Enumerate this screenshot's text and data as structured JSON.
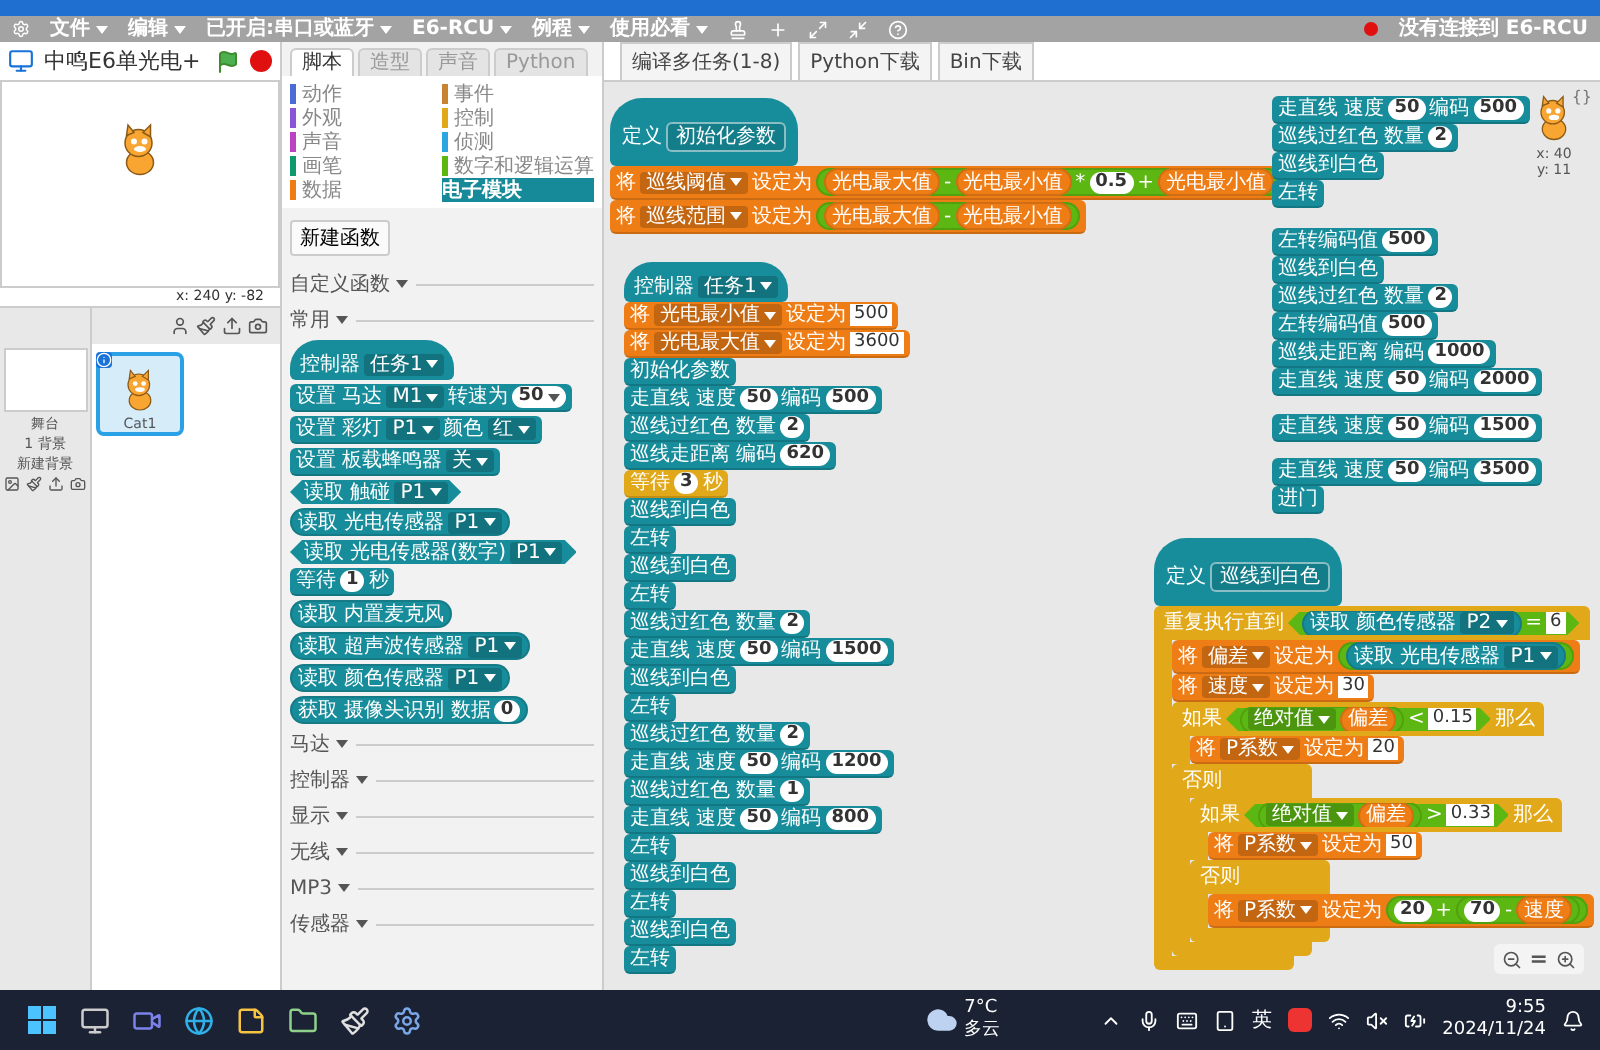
{
  "menu_bar": {
    "items": [
      {
        "label": "文件"
      },
      {
        "label": "编辑"
      },
      {
        "label": "已开启:串口或蓝牙"
      },
      {
        "label": "E6-RCU"
      },
      {
        "label": "例程"
      },
      {
        "label": "使用必看"
      }
    ],
    "connection": {
      "connected": false,
      "text": "没有连接到 E6-RCU"
    }
  },
  "stage": {
    "title": "中鸣E6单光电+",
    "coordinates": "x: 240  y: -82"
  },
  "sprites_pane": {
    "stage_label": "舞台",
    "backdrop_count": "1 背景",
    "new_backdrop": "新建背景",
    "sprites": [
      {
        "name": "Cat1",
        "selected": true
      }
    ]
  },
  "palette": {
    "tabs": [
      {
        "label": "脚本",
        "selected": true
      },
      {
        "label": "造型",
        "selected": false
      },
      {
        "label": "声音",
        "selected": false
      },
      {
        "label": "Python",
        "selected": false
      }
    ],
    "categories": [
      {
        "label": "动作",
        "color": "#4a6cd4",
        "selected": false
      },
      {
        "label": "外观",
        "color": "#8a55d7",
        "selected": false
      },
      {
        "label": "声音",
        "color": "#bb42c3",
        "selected": false
      },
      {
        "label": "画笔",
        "color": "#0e9a6c",
        "selected": false
      },
      {
        "label": "数据",
        "color": "#ee7d16",
        "selected": false
      },
      {
        "label": "事件",
        "color": "#c88330",
        "selected": false
      },
      {
        "label": "控制",
        "color": "#e1a91a",
        "selected": false
      },
      {
        "label": "侦测",
        "color": "#2ca5e2",
        "selected": false
      },
      {
        "label": "数字和逻辑运算",
        "color": "#5cb712",
        "selected": false
      },
      {
        "label": "电子模块",
        "color": "#168a98",
        "selected": true
      }
    ],
    "new_function_button": "新建函数",
    "sections": [
      {
        "label": "自定义函数"
      },
      {
        "label": "常用",
        "blocks": [
          {
            "kind": "hat",
            "color": "#178c9a",
            "parts": [
              {
                "kind": "text",
                "text": "控制器"
              },
              {
                "kind": "dropdown",
                "text": "任务1"
              }
            ]
          },
          {
            "kind": "stack",
            "color": "#178c9a",
            "parts": [
              {
                "kind": "text",
                "text": "设置 马达"
              },
              {
                "kind": "dropdown",
                "text": "M1"
              },
              {
                "kind": "text",
                "text": "转速为"
              },
              {
                "kind": "number_menu",
                "text": "50"
              }
            ]
          },
          {
            "kind": "stack",
            "color": "#178c9a",
            "parts": [
              {
                "kind": "text",
                "text": "设置 彩灯"
              },
              {
                "kind": "dropdown",
                "text": "P1"
              },
              {
                "kind": "text",
                "text": "颜色"
              },
              {
                "kind": "dropdown",
                "text": "红"
              }
            ]
          },
          {
            "kind": "stack",
            "color": "#178c9a",
            "parts": [
              {
                "kind": "text",
                "text": "设置 板载蜂鸣器"
              },
              {
                "kind": "dropdown",
                "text": "关"
              }
            ]
          },
          {
            "kind": "boolean",
            "color": "#178c9a",
            "parts": [
              {
                "kind": "text",
                "text": "读取 触碰"
              },
              {
                "kind": "dropdown",
                "text": "P1"
              }
            ]
          },
          {
            "kind": "reporter",
            "color": "#178c9a",
            "parts": [
              {
                "kind": "text",
                "text": "读取 光电传感器"
              },
              {
                "kind": "dropdown",
                "text": "P1"
              }
            ]
          },
          {
            "kind": "boolean",
            "color": "#178c9a",
            "parts": [
              {
                "kind": "text",
                "text": "读取 光电传感器(数字)"
              },
              {
                "kind": "dropdown",
                "text": "P1"
              }
            ]
          },
          {
            "kind": "stack",
            "color": "#178c9a",
            "parts": [
              {
                "kind": "text",
                "text": "等待"
              },
              {
                "kind": "number",
                "text": "1"
              },
              {
                "kind": "text",
                "text": "秒"
              }
            ]
          },
          {
            "kind": "reporter",
            "color": "#178c9a",
            "parts": [
              {
                "kind": "text",
                "text": "读取 内置麦克风"
              }
            ]
          },
          {
            "kind": "reporter",
            "color": "#178c9a",
            "parts": [
              {
                "kind": "text",
                "text": "读取 超声波传感器"
              },
              {
                "kind": "dropdown",
                "text": "P1"
              }
            ]
          },
          {
            "kind": "reporter",
            "color": "#178c9a",
            "parts": [
              {
                "kind": "text",
                "text": "读取 颜色传感器"
              },
              {
                "kind": "dropdown",
                "text": "P1"
              }
            ]
          },
          {
            "kind": "reporter",
            "color": "#178c9a",
            "parts": [
              {
                "kind": "text",
                "text": "获取 摄像头识别 数据"
              },
              {
                "kind": "number",
                "text": "0"
              }
            ]
          }
        ]
      },
      {
        "label": "马达"
      },
      {
        "label": "控制器"
      },
      {
        "label": "显示"
      },
      {
        "label": "无线"
      },
      {
        "label": "MP3"
      },
      {
        "label": "传感器"
      }
    ]
  },
  "toolbar": {
    "buttons": [
      {
        "label": "编译多任务(1-8)"
      },
      {
        "label": "Python下载"
      },
      {
        "label": "Bin下载"
      }
    ]
  },
  "scripts": [
    [
      {
        "kind": "define",
        "color": "#178c9a",
        "parts": [
          {
            "kind": "text",
            "text": "定义"
          },
          {
            "kind": "slot",
            "text": "初始化参数"
          }
        ]
      },
      {
        "kind": "stack",
        "color": "#ee7d16",
        "parts": [
          {
            "kind": "text",
            "text": "将"
          },
          {
            "kind": "dropdown",
            "text": "巡线阈值"
          },
          {
            "kind": "text",
            "text": "设定为"
          },
          {
            "kind": "reporter",
            "color": "#5cb712",
            "parts": [
              {
                "kind": "reporter",
                "color": "#ee7d16",
                "parts": [
                  {
                    "kind": "text",
                    "text": "光电最大值"
                  }
                ]
              },
              {
                "kind": "text",
                "text": "-"
              },
              {
                "kind": "reporter",
                "color": "#ee7d16",
                "parts": [
                  {
                    "kind": "text",
                    "text": "光电最小值"
                  }
                ]
              },
              {
                "kind": "text",
                "text": "*"
              },
              {
                "kind": "number",
                "text": "0.5"
              },
              {
                "kind": "text",
                "text": "+"
              },
              {
                "kind": "reporter",
                "color": "#ee7d16",
                "parts": [
                  {
                    "kind": "text",
                    "text": "光电最小值"
                  }
                ]
              }
            ]
          }
        ]
      },
      {
        "kind": "stack",
        "color": "#ee7d16",
        "parts": [
          {
            "kind": "text",
            "text": "将"
          },
          {
            "kind": "dropdown",
            "text": "巡线范围"
          },
          {
            "kind": "text",
            "text": "设定为"
          },
          {
            "kind": "reporter",
            "color": "#5cb712",
            "parts": [
              {
                "kind": "reporter",
                "color": "#ee7d16",
                "parts": [
                  {
                    "kind": "text",
                    "text": "光电最大值"
                  }
                ]
              },
              {
                "kind": "text",
                "text": "-"
              },
              {
                "kind": "reporter",
                "color": "#ee7d16",
                "parts": [
                  {
                    "kind": "text",
                    "text": "光电最小值"
                  }
                ]
              }
            ]
          }
        ]
      }
    ],
    [
      {
        "kind": "hat",
        "color": "#178c9a",
        "parts": [
          {
            "kind": "text",
            "text": "控制器"
          },
          {
            "kind": "dropdown",
            "text": "任务1"
          }
        ]
      },
      {
        "kind": "stack",
        "color": "#ee7d16",
        "parts": [
          {
            "kind": "text",
            "text": "将"
          },
          {
            "kind": "dropdown",
            "text": "光电最小值"
          },
          {
            "kind": "text",
            "text": "设定为"
          },
          {
            "kind": "field",
            "text": "500"
          }
        ]
      },
      {
        "kind": "stack",
        "color": "#ee7d16",
        "parts": [
          {
            "kind": "text",
            "text": "将"
          },
          {
            "kind": "dropdown",
            "text": "光电最大值"
          },
          {
            "kind": "text",
            "text": "设定为"
          },
          {
            "kind": "field",
            "text": "3600"
          }
        ]
      },
      {
        "kind": "stack",
        "color": "#178c9a",
        "parts": [
          {
            "kind": "text",
            "text": "初始化参数"
          }
        ]
      },
      {
        "kind": "stack",
        "color": "#178c9a",
        "parts": [
          {
            "kind": "text",
            "text": "走直线 速度"
          },
          {
            "kind": "number",
            "text": "50"
          },
          {
            "kind": "text",
            "text": "编码"
          },
          {
            "kind": "number",
            "text": "500"
          }
        ]
      },
      {
        "kind": "stack",
        "color": "#178c9a",
        "parts": [
          {
            "kind": "text",
            "text": "巡线过红色 数量"
          },
          {
            "kind": "number",
            "text": "2"
          }
        ]
      },
      {
        "kind": "stack",
        "color": "#178c9a",
        "parts": [
          {
            "kind": "text",
            "text": "巡线走距离 编码"
          },
          {
            "kind": "number",
            "text": "620"
          }
        ]
      },
      {
        "kind": "stack",
        "color": "#e1a91a",
        "parts": [
          {
            "kind": "text",
            "text": "等待"
          },
          {
            "kind": "number",
            "text": "3"
          },
          {
            "kind": "text",
            "text": "秒"
          }
        ]
      },
      {
        "kind": "stack",
        "color": "#178c9a",
        "parts": [
          {
            "kind": "text",
            "text": "巡线到白色"
          }
        ]
      },
      {
        "kind": "stack",
        "color": "#178c9a",
        "parts": [
          {
            "kind": "text",
            "text": "左转"
          }
        ]
      },
      {
        "kind": "stack",
        "color": "#178c9a",
        "parts": [
          {
            "kind": "text",
            "text": "巡线到白色"
          }
        ]
      },
      {
        "kind": "stack",
        "color": "#178c9a",
        "parts": [
          {
            "kind": "text",
            "text": "左转"
          }
        ]
      },
      {
        "kind": "stack",
        "color": "#178c9a",
        "parts": [
          {
            "kind": "text",
            "text": "巡线过红色 数量"
          },
          {
            "kind": "number",
            "text": "2"
          }
        ]
      },
      {
        "kind": "stack",
        "color": "#178c9a",
        "parts": [
          {
            "kind": "text",
            "text": "走直线 速度"
          },
          {
            "kind": "number",
            "text": "50"
          },
          {
            "kind": "text",
            "text": "编码"
          },
          {
            "kind": "number",
            "text": "1500"
          }
        ]
      },
      {
        "kind": "stack",
        "color": "#178c9a",
        "parts": [
          {
            "kind": "text",
            "text": "巡线到白色"
          }
        ]
      },
      {
        "kind": "stack",
        "color": "#178c9a",
        "parts": [
          {
            "kind": "text",
            "text": "左转"
          }
        ]
      },
      {
        "kind": "stack",
        "color": "#178c9a",
        "parts": [
          {
            "kind": "text",
            "text": "巡线过红色 数量"
          },
          {
            "kind": "number",
            "text": "2"
          }
        ]
      },
      {
        "kind": "stack",
        "color": "#178c9a",
        "parts": [
          {
            "kind": "text",
            "text": "走直线 速度"
          },
          {
            "kind": "number",
            "text": "50"
          },
          {
            "kind": "text",
            "text": "编码"
          },
          {
            "kind": "number",
            "text": "1200"
          }
        ]
      },
      {
        "kind": "stack",
        "color": "#178c9a",
        "parts": [
          {
            "kind": "text",
            "text": "巡线过红色 数量"
          },
          {
            "kind": "number",
            "text": "1"
          }
        ]
      },
      {
        "kind": "stack",
        "color": "#178c9a",
        "parts": [
          {
            "kind": "text",
            "text": "走直线 速度"
          },
          {
            "kind": "number",
            "text": "50"
          },
          {
            "kind": "text",
            "text": "编码"
          },
          {
            "kind": "number",
            "text": "800"
          }
        ]
      },
      {
        "kind": "stack",
        "color": "#178c9a",
        "parts": [
          {
            "kind": "text",
            "text": "左转"
          }
        ]
      },
      {
        "kind": "stack",
        "color": "#178c9a",
        "parts": [
          {
            "kind": "text",
            "text": "巡线到白色"
          }
        ]
      },
      {
        "kind": "stack",
        "color": "#178c9a",
        "parts": [
          {
            "kind": "text",
            "text": "左转"
          }
        ]
      },
      {
        "kind": "stack",
        "color": "#178c9a",
        "parts": [
          {
            "kind": "text",
            "text": "巡线到白色"
          }
        ]
      },
      {
        "kind": "stack",
        "color": "#178c9a",
        "parts": [
          {
            "kind": "text",
            "text": "左转"
          }
        ]
      }
    ],
    [
      {
        "kind": "stack",
        "color": "#178c9a",
        "parts": [
          {
            "kind": "text",
            "text": "走直线 速度"
          },
          {
            "kind": "number",
            "text": "50"
          },
          {
            "kind": "text",
            "text": "编码"
          },
          {
            "kind": "number",
            "text": "500"
          }
        ]
      },
      {
        "kind": "stack",
        "color": "#178c9a",
        "parts": [
          {
            "kind": "text",
            "text": "巡线过红色 数量"
          },
          {
            "kind": "number",
            "text": "2"
          }
        ]
      },
      {
        "kind": "stack",
        "color": "#178c9a",
        "parts": [
          {
            "kind": "text",
            "text": "巡线到白色"
          }
        ]
      },
      {
        "kind": "stack",
        "color": "#178c9a",
        "parts": [
          {
            "kind": "text",
            "text": "左转"
          }
        ]
      }
    ],
    [
      {
        "kind": "stack",
        "color": "#178c9a",
        "parts": [
          {
            "kind": "text",
            "text": "左转编码值"
          },
          {
            "kind": "number",
            "text": "500"
          }
        ]
      },
      {
        "kind": "stack",
        "color": "#178c9a",
        "parts": [
          {
            "kind": "text",
            "text": "巡线到白色"
          }
        ]
      },
      {
        "kind": "stack",
        "color": "#178c9a",
        "parts": [
          {
            "kind": "text",
            "text": "巡线过红色 数量"
          },
          {
            "kind": "number",
            "text": "2"
          }
        ]
      },
      {
        "kind": "stack",
        "color": "#178c9a",
        "parts": [
          {
            "kind": "text",
            "text": "左转编码值"
          },
          {
            "kind": "number",
            "text": "500"
          }
        ]
      },
      {
        "kind": "stack",
        "color": "#178c9a",
        "parts": [
          {
            "kind": "text",
            "text": "巡线走距离 编码"
          },
          {
            "kind": "number",
            "text": "1000"
          }
        ]
      },
      {
        "kind": "stack",
        "color": "#178c9a",
        "parts": [
          {
            "kind": "text",
            "text": "走直线 速度"
          },
          {
            "kind": "number",
            "text": "50"
          },
          {
            "kind": "text",
            "text": "编码"
          },
          {
            "kind": "number",
            "text": "2000"
          }
        ]
      }
    ],
    [
      {
        "kind": "stack",
        "color": "#178c9a",
        "parts": [
          {
            "kind": "text",
            "text": "走直线 速度"
          },
          {
            "kind": "number",
            "text": "50"
          },
          {
            "kind": "text",
            "text": "编码"
          },
          {
            "kind": "number",
            "text": "1500"
          }
        ]
      }
    ],
    [
      {
        "kind": "stack",
        "color": "#178c9a",
        "parts": [
          {
            "kind": "text",
            "text": "走直线 速度"
          },
          {
            "kind": "number",
            "text": "50"
          },
          {
            "kind": "text",
            "text": "编码"
          },
          {
            "kind": "number",
            "text": "3500"
          }
        ]
      },
      {
        "kind": "stack",
        "color": "#178c9a",
        "parts": [
          {
            "kind": "text",
            "text": "进门"
          }
        ]
      }
    ],
    [
      {
        "kind": "define",
        "color": "#178c9a",
        "parts": [
          {
            "kind": "text",
            "text": "定义"
          },
          {
            "kind": "slot",
            "text": "巡线到白色"
          }
        ]
      },
      {
        "kind": "c",
        "color": "#e1a91a",
        "sections": [
          {
            "parts": [
              {
                "kind": "text",
                "text": "重复执行直到"
              },
              {
                "kind": "boolean",
                "color": "#5cb712",
                "parts": [
                  {
                    "kind": "reporter",
                    "color": "#178c9a",
                    "parts": [
                      {
                        "kind": "text",
                        "text": "读取 颜色传感器"
                      },
                      {
                        "kind": "dropdown",
                        "text": "P2"
                      }
                    ]
                  },
                  {
                    "kind": "text",
                    "text": "="
                  },
                  {
                    "kind": "field",
                    "text": "6"
                  }
                ]
              }
            ],
            "body": [
              {
                "kind": "stack",
                "color": "#ee7d16",
                "parts": [
                  {
                    "kind": "text",
                    "text": "将"
                  },
                  {
                    "kind": "dropdown",
                    "text": "偏差"
                  },
                  {
                    "kind": "text",
                    "text": "设定为"
                  },
                  {
                    "kind": "reporter",
                    "color": "#5cb712",
                    "parts": [
                      {
                        "kind": "reporter",
                        "color": "#178c9a",
                        "parts": [
                          {
                            "kind": "text",
                            "text": "读取 光电传感器"
                          },
                          {
                            "kind": "dropdown",
                            "text": "P1"
                          }
                        ]
                      }
                    ]
                  }
                ]
              },
              {
                "kind": "stack",
                "color": "#ee7d16",
                "parts": [
                  {
                    "kind": "text",
                    "text": "将"
                  },
                  {
                    "kind": "dropdown",
                    "text": "速度"
                  },
                  {
                    "kind": "text",
                    "text": "设定为"
                  },
                  {
                    "kind": "field",
                    "text": "30"
                  }
                ]
              },
              {
                "kind": "c",
                "color": "#e1a91a",
                "sections": [
                  {
                    "parts": [
                      {
                        "kind": "text",
                        "text": "如果"
                      },
                      {
                        "kind": "boolean",
                        "color": "#5cb712",
                        "parts": [
                          {
                            "kind": "reporter",
                            "color": "#5cb712",
                            "parts": [
                              {
                                "kind": "dropdown",
                                "text": "绝对值"
                              },
                              {
                                "kind": "reporter",
                                "color": "#ee7d16",
                                "parts": [
                                  {
                                    "kind": "text",
                                    "text": "偏差"
                                  }
                                ]
                              }
                            ]
                          },
                          {
                            "kind": "text",
                            "text": "<"
                          },
                          {
                            "kind": "field",
                            "text": "0.15"
                          }
                        ]
                      },
                      {
                        "kind": "text",
                        "text": "那么"
                      }
                    ],
                    "body": [
                      {
                        "kind": "stack",
                        "color": "#ee7d16",
                        "parts": [
                          {
                            "kind": "text",
                            "text": "将"
                          },
                          {
                            "kind": "dropdown",
                            "text": "P系数"
                          },
                          {
                            "kind": "text",
                            "text": "设定为"
                          },
                          {
                            "kind": "field",
                            "text": "20"
                          }
                        ]
                      }
                    ]
                  },
                  {
                    "parts": [
                      {
                        "kind": "text",
                        "text": "否则"
                      }
                    ],
                    "body": [
                      {
                        "kind": "c",
                        "color": "#e1a91a",
                        "sections": [
                          {
                            "parts": [
                              {
                                "kind": "text",
                                "text": "如果"
                              },
                              {
                                "kind": "boolean",
                                "color": "#5cb712",
                                "parts": [
                                  {
                                    "kind": "reporter",
                                    "color": "#5cb712",
                                    "parts": [
                                      {
                                        "kind": "dropdown",
                                        "text": "绝对值"
                                      },
                                      {
                                        "kind": "reporter",
                                        "color": "#ee7d16",
                                        "parts": [
                                          {
                                            "kind": "text",
                                            "text": "偏差"
                                          }
                                        ]
                                      }
                                    ]
                                  },
                                  {
                                    "kind": "text",
                                    "text": ">"
                                  },
                                  {
                                    "kind": "field",
                                    "text": "0.33"
                                  }
                                ]
                              },
                              {
                                "kind": "text",
                                "text": "那么"
                              }
                            ],
                            "body": [
                              {
                                "kind": "stack",
                                "color": "#ee7d16",
                                "parts": [
                                  {
                                    "kind": "text",
                                    "text": "将"
                                  },
                                  {
                                    "kind": "dropdown",
                                    "text": "P系数"
                                  },
                                  {
                                    "kind": "text",
                                    "text": "设定为"
                                  },
                                  {
                                    "kind": "field",
                                    "text": "50"
                                  }
                                ]
                              }
                            ]
                          },
                          {
                            "parts": [
                              {
                                "kind": "text",
                                "text": "否则"
                              }
                            ],
                            "body": [
                              {
                                "kind": "stack",
                                "color": "#ee7d16",
                                "parts": [
                                  {
                                    "kind": "text",
                                    "text": "将"
                                  },
                                  {
                                    "kind": "dropdown",
                                    "text": "P系数"
                                  },
                                  {
                                    "kind": "text",
                                    "text": "设定为"
                                  },
                                  {
                                    "kind": "reporter",
                                    "color": "#5cb712",
                                    "parts": [
                                      {
                                        "kind": "number",
                                        "text": "20"
                                      },
                                      {
                                        "kind": "text",
                                        "text": "+"
                                      },
                                      {
                                        "kind": "reporter",
                                        "color": "#5cb712",
                                        "parts": [
                                          {
                                            "kind": "number",
                                            "text": "70"
                                          },
                                          {
                                            "kind": "text",
                                            "text": "-"
                                          },
                                          {
                                            "kind": "reporter",
                                            "color": "#ee7d16",
                                            "parts": [
                                              {
                                                "kind": "text",
                                                "text": "速度"
                                              }
                                            ]
                                          }
                                        ]
                                      }
                                    ]
                                  }
                                ]
                              }
                            ]
                          }
                        ]
                      }
                    ]
                  }
                ]
              }
            ]
          }
        ]
      }
    ]
  ],
  "sprite_info": {
    "x": "x: 40",
    "y": "y: 11",
    "corner_mark": "{}"
  },
  "zoom": {
    "reset_label": "="
  },
  "taskbar": {
    "weather": {
      "temperature": "7°C",
      "condition": "多云"
    },
    "input_method": "英",
    "time": "9:55",
    "date": "2024/11/24"
  }
}
